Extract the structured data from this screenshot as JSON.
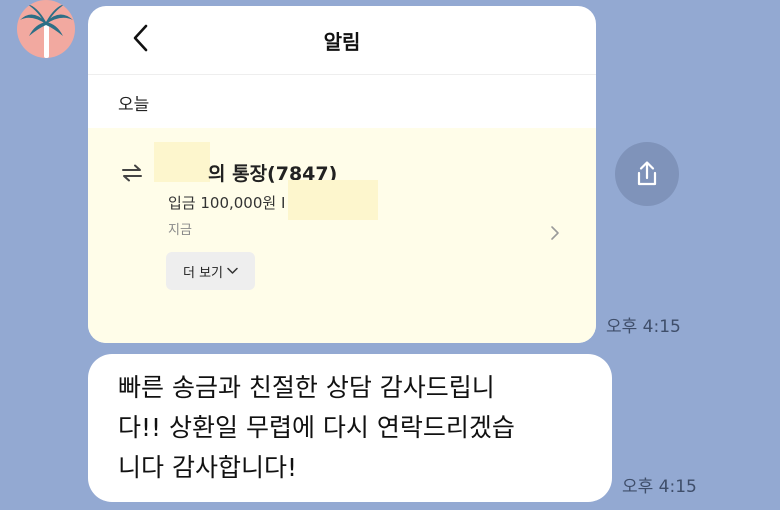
{
  "avatar": {
    "icon": "palm-tree-icon",
    "background": "#f2a9a0"
  },
  "card": {
    "title": "알림",
    "section_label": "오늘",
    "notification": {
      "account": "의 통장(7847)",
      "amount": "입금 100,000원 I",
      "time": "지금",
      "more_label": "더 보기",
      "background": "#fffde9"
    },
    "timestamp": "오후 4:15"
  },
  "message": {
    "lines": [
      "빠른 송금과 친절한 상담 감사드립니",
      "다!! 상환일 무렵에 다시 연락드리겠습",
      "니다 감사합니다!"
    ],
    "timestamp": "오후 4:15"
  },
  "colors": {
    "chat_background": "#93a9d2",
    "share_button": "#7f93ba"
  }
}
